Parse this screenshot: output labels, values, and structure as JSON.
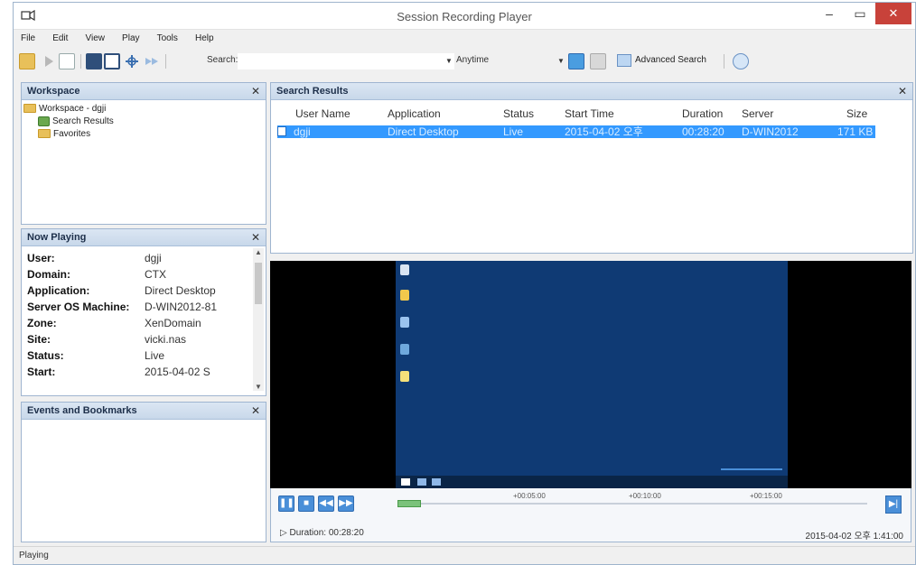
{
  "window": {
    "title": "Session Recording Player",
    "minimize_glyph": "–",
    "maximize_glyph": "▭",
    "close_glyph": "✕"
  },
  "menu": {
    "items": [
      "File",
      "Edit",
      "View",
      "Play",
      "Tools",
      "Help"
    ]
  },
  "toolbar": {
    "search_label": "Search:",
    "search_value": "",
    "time_filter": "Anytime",
    "advanced_search_label": "Advanced Search"
  },
  "workspace": {
    "header": "Workspace",
    "tree": [
      "Workspace - dgji",
      "Search Results",
      "Favorites"
    ]
  },
  "now_playing": {
    "header": "Now Playing",
    "rows": [
      {
        "label": "User:",
        "value": "dgji"
      },
      {
        "label": "Domain:",
        "value": "CTX"
      },
      {
        "label": "Application:",
        "value": "Direct Desktop"
      },
      {
        "label": "Server OS Machine:",
        "value": "D-WIN2012-81"
      },
      {
        "label": "Zone:",
        "value": "XenDomain"
      },
      {
        "label": "Site:",
        "value": "vicki.nas"
      },
      {
        "label": "Status:",
        "value": "Live"
      },
      {
        "label": "Start:",
        "value": "2015-04-02 S"
      }
    ]
  },
  "events": {
    "header": "Events and Bookmarks"
  },
  "search_results": {
    "header": "Search Results",
    "columns": [
      "User Name",
      "Application",
      "Status",
      "Start Time",
      "Duration",
      "Server",
      "Size"
    ],
    "rows": [
      {
        "user": "dgji",
        "application": "Direct Desktop",
        "status": "Live",
        "start_time": "2015-04-02 오후",
        "duration": "00:28:20",
        "server": "D-WIN2012",
        "size": "171 KB"
      }
    ]
  },
  "player": {
    "tick_labels": [
      "+00:05:00",
      "+00:10:00",
      "+00:15:00"
    ],
    "duration_text": "Duration: 00:28:20",
    "clock_text": "2015-04-02 오후 1:41:00",
    "progress": 0.05
  },
  "status": {
    "text": "Playing"
  },
  "colors": {
    "accent": "#3399ff",
    "panel_header": "#c8d8ea",
    "desktop_bg": "#0f3a74",
    "close_red": "#c8423a"
  }
}
